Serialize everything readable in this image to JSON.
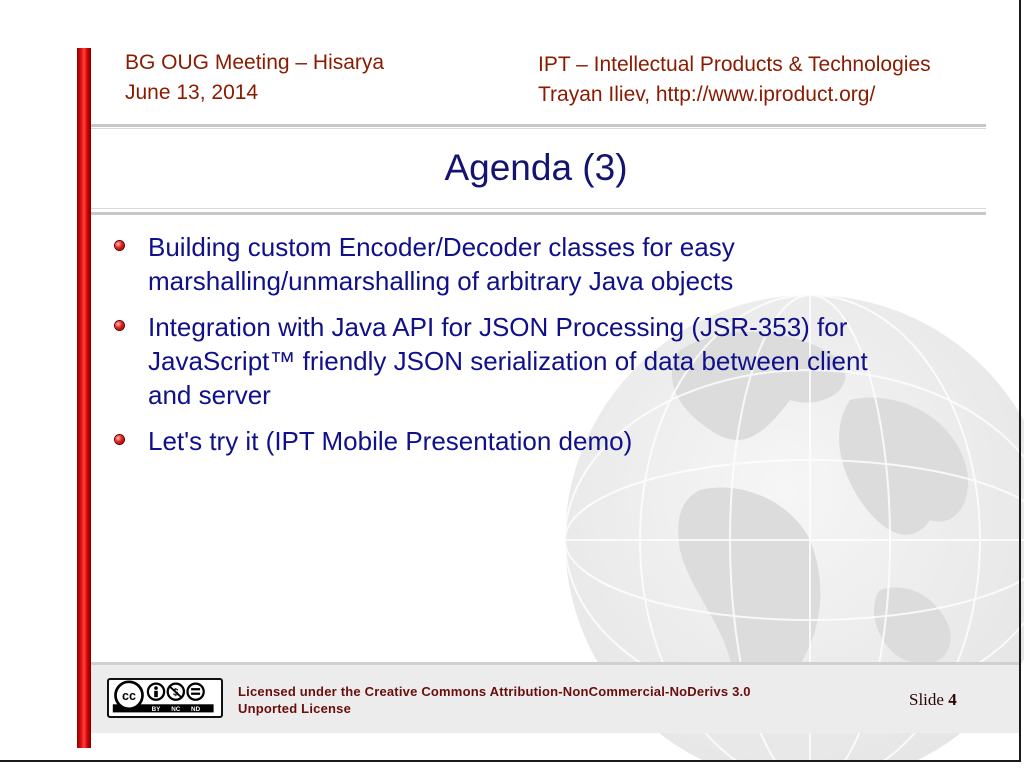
{
  "header": {
    "left_line1": "BG OUG Meeting – Hisarya",
    "left_line2": "June 13, 2014",
    "right_line1": "IPT – Intellectual Products & Technologies",
    "right_line2": "Trayan Iliev, http://www.iproduct.org/"
  },
  "slide": {
    "title": "Agenda (3)",
    "bullets": [
      {
        "line1": "Building custom Encoder/Decoder classes for easy",
        "line2": "marshalling/unmarshalling of arbitrary Java objects",
        "line3": ""
      },
      {
        "line1": "Integration with Java API for JSON Processing (JSR-353) for",
        "line2": "JavaScript™ friendly JSON serialization of data between client",
        "line3": "and server"
      },
      {
        "line1": "Let's try it (IPT Mobile Presentation demo)",
        "line2": "",
        "line3": ""
      }
    ]
  },
  "footer": {
    "license_line1": "Licensed under the Creative Commons Attribution-NonCommercial-NoDerivs 3.0",
    "license_line2": "Unported License",
    "slide_label": "Slide",
    "slide_number": "4",
    "cc_logo": {
      "cc": "cc",
      "by": "BY",
      "nc": "NC",
      "nd": "ND"
    }
  },
  "colors": {
    "header_text": "#8a1a00",
    "title": "#141470",
    "body_text": "#10108a",
    "accent_bar": "#e01010"
  },
  "icons": [
    "creative-commons-logo",
    "bullet-icon",
    "globe-watermark"
  ]
}
